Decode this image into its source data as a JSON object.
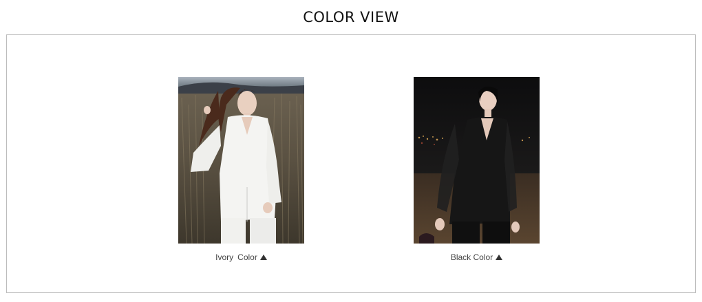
{
  "page": {
    "title": "COLOR VIEW"
  },
  "swatches": [
    {
      "color_name": "Ivory",
      "color_word": "Color",
      "icon": "triangle-up-icon",
      "garment_color": "#f4f4f2"
    },
    {
      "color_name": "Black",
      "color_word": "Color",
      "icon": "triangle-up-icon",
      "garment_color": "#161616"
    }
  ]
}
